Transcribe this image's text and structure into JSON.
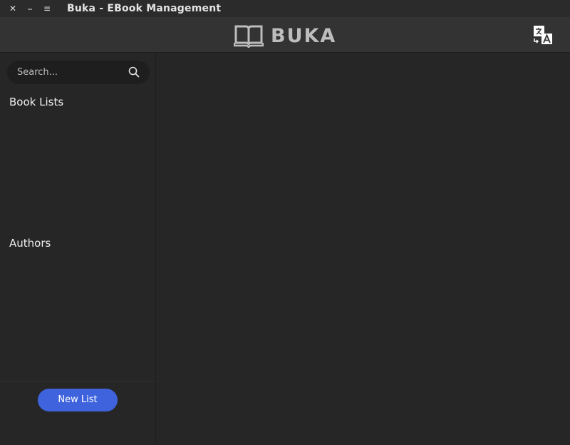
{
  "window": {
    "title": "Buka - EBook Management",
    "close_glyph": "✕",
    "minimize_glyph": "⎯",
    "maximize_glyph": "≡"
  },
  "header": {
    "logo_text": "BUKA",
    "logo_icon": "open-book-icon",
    "translate_icon": "translate-icon"
  },
  "sidebar": {
    "search": {
      "placeholder": "Search...",
      "value": "",
      "icon": "search-icon"
    },
    "book_lists_heading": "Book Lists",
    "authors_heading": "Authors",
    "new_list_label": "New List"
  },
  "colors": {
    "accent": "#3e63dd",
    "background": "#262626",
    "header": "#333333",
    "titlebar": "#2b2b2b"
  }
}
